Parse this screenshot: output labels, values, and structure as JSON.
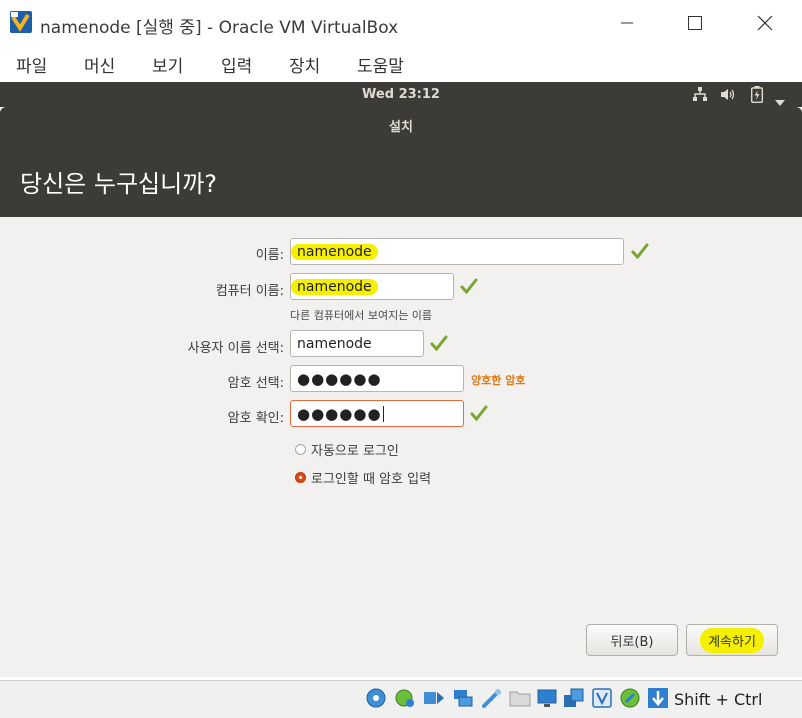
{
  "window": {
    "title": "namenode [실행 중] - Oracle VM VirtualBox"
  },
  "menu": [
    "파일",
    "머신",
    "보기",
    "입력",
    "장치",
    "도움말"
  ],
  "panel": {
    "clock": "Wed 23:12"
  },
  "dialog": {
    "title": "설치",
    "heading": "당신은 누구십니까?"
  },
  "form": {
    "name_label": "이름:",
    "name_value": "namenode",
    "computer_label": "컴퓨터 이름:",
    "computer_value": "namenode",
    "computer_hint": "다른 컴퓨터에서 보여지는 이름",
    "username_label": "사용자 이름 선택:",
    "username_value": "namenode",
    "password_label": "암호 선택:",
    "password_value": "●●●●●●",
    "password_strength": "양호한 암호",
    "confirm_label": "암호 확인:",
    "confirm_value": "●●●●●●",
    "radio_auto": "자동으로 로그인",
    "radio_password": "로그인할 때 암호 입력"
  },
  "buttons": {
    "back": "뒤로(B)",
    "continue": "계속하기"
  },
  "statusbar": {
    "host_key": "Shift + Ctrl"
  },
  "colors": {
    "panel": "#3c3b37",
    "accent": "#dd4814",
    "highlight": "#f5ef00",
    "check": "#7aa630",
    "strength": "#e07a14"
  }
}
